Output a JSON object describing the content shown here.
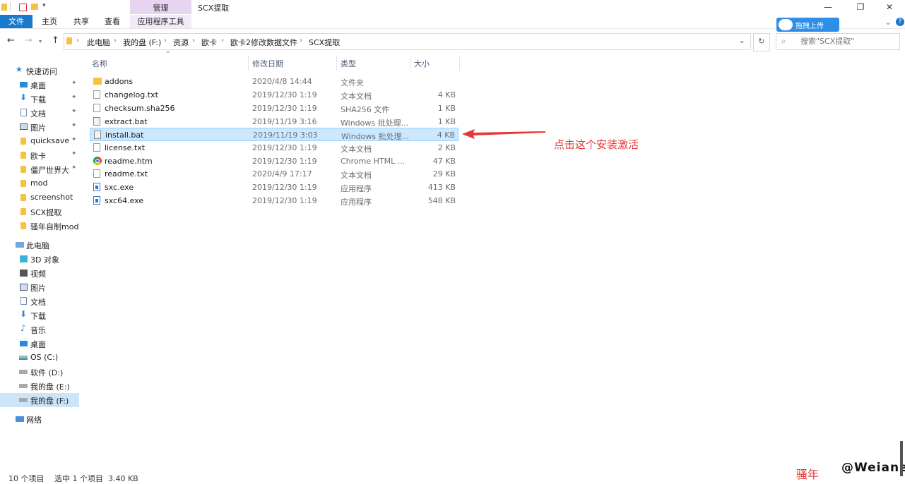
{
  "window": {
    "title": "SCX提取",
    "minimize_glyph": "—",
    "restore_glyph": "❐",
    "close_glyph": "✕"
  },
  "ribbon": {
    "contextual_group": "管理",
    "tabs": [
      "文件",
      "主页",
      "共享",
      "查看",
      "应用程序工具"
    ],
    "help_glyph": "?",
    "collapse_glyph": "⌄"
  },
  "upload_widget": {
    "label": "拖拽上传"
  },
  "address": {
    "crumbs": [
      "此电脑",
      "我的盘 (F:)",
      "资源",
      "欧卡",
      "欧卡2修改数据文件",
      "SCX提取"
    ],
    "separator": "›",
    "back_glyph": "←",
    "forward_glyph": "→",
    "up_glyph": "↑",
    "refresh_glyph": "↻",
    "dropdown_glyph": "⌄"
  },
  "search": {
    "placeholder": "搜索\"SCX提取\""
  },
  "sidebar": {
    "quick_access": "快速访问",
    "quick_items": [
      {
        "label": "桌面",
        "icon": "desktop-icon",
        "pinned": true
      },
      {
        "label": "下载",
        "icon": "download-icon",
        "pinned": true
      },
      {
        "label": "文档",
        "icon": "document-icon",
        "pinned": true
      },
      {
        "label": "图片",
        "icon": "picture-icon",
        "pinned": true
      },
      {
        "label": "quicksave",
        "icon": "folder-icon",
        "pinned": true
      },
      {
        "label": "欧卡",
        "icon": "folder-icon",
        "pinned": true
      },
      {
        "label": "僵尸世界大",
        "icon": "folder-icon",
        "pinned": true
      },
      {
        "label": "mod",
        "icon": "folder-icon",
        "pinned": false
      },
      {
        "label": "screenshot",
        "icon": "folder-icon",
        "pinned": false
      },
      {
        "label": "SCX提取",
        "icon": "folder-icon",
        "pinned": false
      },
      {
        "label": "骚年自制mod",
        "icon": "folder-icon",
        "pinned": false
      }
    ],
    "this_pc": "此电脑",
    "pc_items": [
      {
        "label": "3D 对象",
        "icon": "3d-objects-icon"
      },
      {
        "label": "视频",
        "icon": "video-icon"
      },
      {
        "label": "图片",
        "icon": "picture-icon"
      },
      {
        "label": "文档",
        "icon": "document-icon"
      },
      {
        "label": "下载",
        "icon": "download-icon"
      },
      {
        "label": "音乐",
        "icon": "music-icon"
      },
      {
        "label": "桌面",
        "icon": "desktop-icon"
      },
      {
        "label": "OS (C:)",
        "icon": "drive-icon"
      },
      {
        "label": "软件 (D:)",
        "icon": "drive-icon"
      },
      {
        "label": "我的盘 (E:)",
        "icon": "drive-icon"
      },
      {
        "label": "我的盘 (F:)",
        "icon": "drive-icon"
      }
    ],
    "network": "网络",
    "pin_glyph": "📌"
  },
  "columns": {
    "name": "名称",
    "date": "修改日期",
    "type": "类型",
    "size": "大小",
    "sort_glyph": "^"
  },
  "files": [
    {
      "name": "addons",
      "date": "2020/4/8 14:44",
      "type": "文件夹",
      "size": "",
      "icon": "folder"
    },
    {
      "name": "changelog.txt",
      "date": "2019/12/30 1:19",
      "type": "文本文档",
      "size": "4 KB",
      "icon": "doc"
    },
    {
      "name": "checksum.sha256",
      "date": "2019/12/30 1:19",
      "type": "SHA256 文件",
      "size": "1 KB",
      "icon": "doc"
    },
    {
      "name": "extract.bat",
      "date": "2019/11/19 3:16",
      "type": "Windows 批处理...",
      "size": "1 KB",
      "icon": "bat"
    },
    {
      "name": "install.bat",
      "date": "2019/11/19 3:03",
      "type": "Windows 批处理...",
      "size": "4 KB",
      "icon": "bat",
      "selected": true
    },
    {
      "name": "license.txt",
      "date": "2019/12/30 1:19",
      "type": "文本文档",
      "size": "2 KB",
      "icon": "doc"
    },
    {
      "name": "readme.htm",
      "date": "2019/12/30 1:19",
      "type": "Chrome HTML ...",
      "size": "47 KB",
      "icon": "chrome"
    },
    {
      "name": "readme.txt",
      "date": "2020/4/9 17:17",
      "type": "文本文档",
      "size": "29 KB",
      "icon": "doc"
    },
    {
      "name": "sxc.exe",
      "date": "2019/12/30 1:19",
      "type": "应用程序",
      "size": "413 KB",
      "icon": "exe"
    },
    {
      "name": "sxc64.exe",
      "date": "2019/12/30 1:19",
      "type": "应用程序",
      "size": "548 KB",
      "icon": "exe"
    }
  ],
  "annotation": {
    "text": "点击这个安装激活",
    "color": "#e53935"
  },
  "status": {
    "count": "10 个项目",
    "selection": "选中 1 个项目  3.40 KB"
  },
  "watermark": {
    "text": "骚年",
    "logo_text": "@Weiane"
  },
  "colors": {
    "accent": "#1979ca",
    "selection": "#cce8ff",
    "manage_band": "#e7d4f0",
    "upload": "#2f8fe6"
  }
}
